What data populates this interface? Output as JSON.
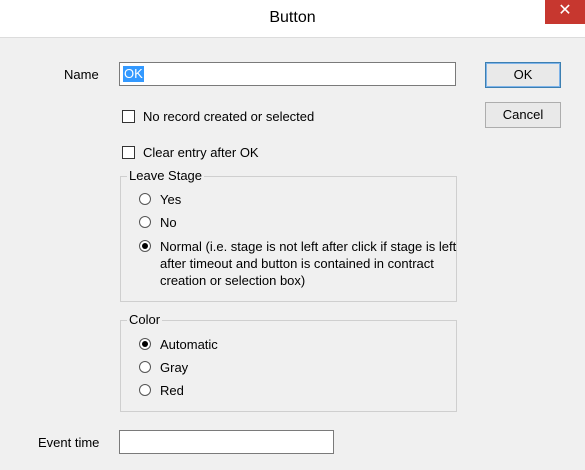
{
  "window": {
    "title": "Button",
    "close_glyph": "✕"
  },
  "name_field": {
    "label": "Name",
    "value": "OK"
  },
  "buttons": {
    "ok": "OK",
    "cancel": "Cancel"
  },
  "checkboxes": {
    "no_record": {
      "label": "No record created or selected",
      "checked": false
    },
    "clear_entry": {
      "label": "Clear entry after OK",
      "checked": false
    }
  },
  "leave_stage": {
    "title": "Leave Stage",
    "options": [
      {
        "label": "Yes",
        "selected": false
      },
      {
        "label": "No",
        "selected": false
      },
      {
        "label": "Normal (i.e. stage is not left after click if stage is left after timeout and button is contained in contract creation or selection box)",
        "selected": true
      }
    ]
  },
  "color": {
    "title": "Color",
    "options": [
      {
        "label": "Automatic",
        "selected": true
      },
      {
        "label": "Gray",
        "selected": false
      },
      {
        "label": "Red",
        "selected": false
      }
    ]
  },
  "event_time": {
    "label": "Event time",
    "value": ""
  },
  "theme": {
    "close_color": "#c7372f",
    "selection_color": "#3399ff"
  }
}
